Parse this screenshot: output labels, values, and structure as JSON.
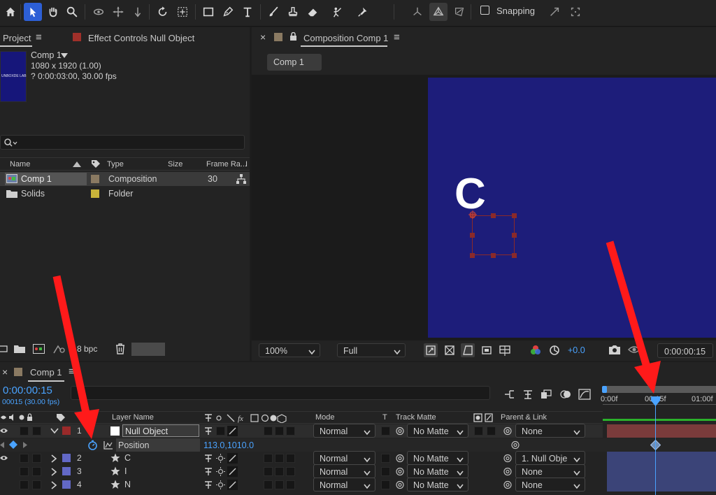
{
  "toolbar": {
    "snapping_label": "Snapping"
  },
  "project": {
    "tab_label": "Project",
    "effect_controls_label": "Effect Controls Null Object",
    "thumb_text": "UNBOXDE LAB",
    "comp_name": "Comp 1",
    "comp_dims": "1080 x 1920 (1.00)",
    "comp_duration": "? 0:00:03:00, 30.00 fps",
    "columns": {
      "name": "Name",
      "type": "Type",
      "size": "Size",
      "frame_rate": "Frame Ra...",
      "extra": "I"
    },
    "items": [
      {
        "name": "Comp 1",
        "type": "Composition",
        "frame_rate": "30",
        "color": "#8a7a62"
      },
      {
        "name": "Solids",
        "type": "Folder",
        "frame_rate": "",
        "color": "#c9b43a"
      }
    ],
    "bpc_label": "8 bpc"
  },
  "composition": {
    "tab_label": "Composition Comp 1",
    "sub_tab": "Comp 1",
    "canvas_color": "#1d1d7a",
    "letter": "C",
    "zoom": "100%",
    "resolution": "Full",
    "exposure": "+0.0",
    "timecode": "0:00:00:15"
  },
  "timeline": {
    "tab_label": "Comp 1",
    "current_time": "0:00:00:15",
    "frame_info": "00015 (30.00 fps)",
    "columns": {
      "layer_name": "Layer Name",
      "mode": "Mode",
      "t": "T",
      "track_matte": "Track Matte",
      "parent_link": "Parent & Link"
    },
    "ruler": {
      "t0": "0:00f",
      "t1": "00:15f",
      "t2": "01:00f"
    },
    "layers": [
      {
        "index": "1",
        "name": "Null Object",
        "mode": "Normal",
        "matte": "No Matte",
        "parent": "None",
        "color": "#9a2a2a"
      },
      {
        "index": "2",
        "name": "C",
        "mode": "Normal",
        "matte": "No Matte",
        "parent": "1. Null Obje",
        "color": "#6268c6"
      },
      {
        "index": "3",
        "name": "I",
        "mode": "Normal",
        "matte": "No Matte",
        "parent": "None",
        "color": "#6268c6"
      },
      {
        "index": "4",
        "name": "N",
        "mode": "Normal",
        "matte": "No Matte",
        "parent": "None",
        "color": "#6268c6"
      }
    ],
    "position_property": {
      "label": "Position",
      "value": "113.0,1010.0"
    }
  }
}
